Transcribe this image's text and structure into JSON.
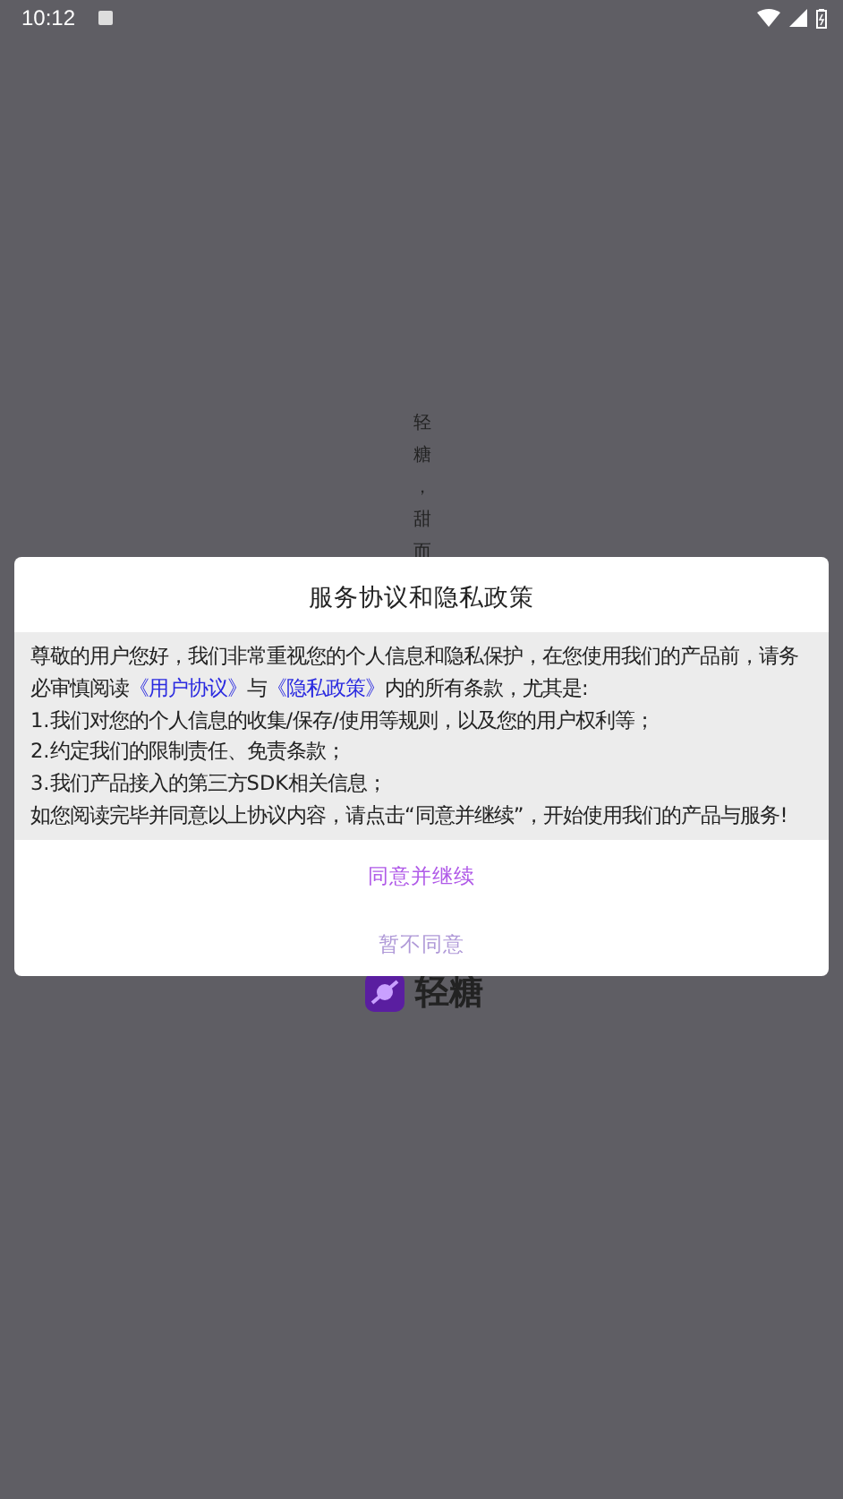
{
  "status_bar": {
    "time": "10:12"
  },
  "splash": {
    "slogan": "轻糖，甜而",
    "logo_text": "轻糖"
  },
  "dialog": {
    "title": "服务协议和隐私政策",
    "intro": [
      {
        "kind": "text",
        "text": "尊敬的用户您好，我们非常重视您的个人信息和隐私保护，在您使用我们的产品前，请务必审慎阅读"
      },
      {
        "kind": "link",
        "text": "《用户协议》"
      },
      {
        "kind": "text",
        "text": "与"
      },
      {
        "kind": "link",
        "text": "《隐私政策》"
      },
      {
        "kind": "text",
        "text": "内的所有条款，尤其是:"
      }
    ],
    "items": [
      "1.我们对您的个人信息的收集/保存/使用等规则，以及您的用户权利等；",
      "2.约定我们的限制责任、免责条款；",
      "3.我们产品接入的第三方SDK相关信息；"
    ],
    "closing": "如您阅读完毕并同意以上协议内容，请点击“同意并继续”，开始使用我们的产品与服务!",
    "buttons": [
      {
        "label": "同意并继续",
        "kind": "primary"
      },
      {
        "label": "暂不同意",
        "kind": "secondary"
      }
    ]
  }
}
